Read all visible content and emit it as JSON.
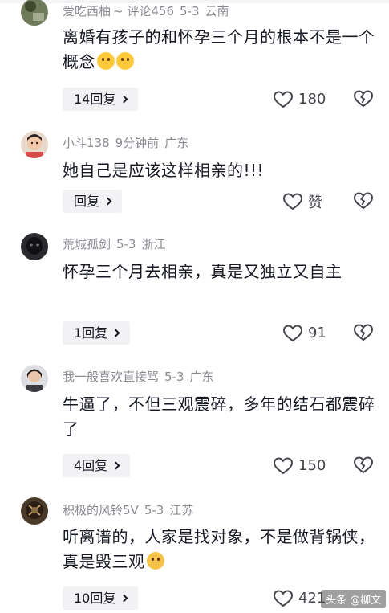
{
  "comments": [
    {
      "user": "爱吃西柚",
      "extra": "~ 评论456",
      "date": "5-3",
      "location": "云南",
      "text": "离婚有孩子的和怀孕三个月的根本不是一个概念",
      "emoji_count": 2,
      "reply_label": "14回复",
      "like_label": "180"
    },
    {
      "user": "小斗138",
      "extra": "",
      "date": "9分钟前",
      "location": "广东",
      "text": "她自己是应该这样相亲的!!!",
      "emoji_count": 0,
      "reply_label": "回复",
      "like_label": "赞"
    },
    {
      "user": "荒城孤剑",
      "extra": "",
      "date": "5-3",
      "location": "浙江",
      "text": "怀孕三个月去相亲，真是又独立又自主",
      "emoji_count": 0,
      "reply_label": "1回复",
      "like_label": "91"
    },
    {
      "user": "我一般喜欢直接骂",
      "extra": "",
      "date": "5-3",
      "location": "广东",
      "text": "牛逼了，不但三观震碎，多年的结石都震碎了",
      "emoji_count": 0,
      "reply_label": "4回复",
      "like_label": "150"
    },
    {
      "user": "积极的风铃5V",
      "extra": "",
      "date": "5-3",
      "location": "江苏",
      "text": "听离谱的，人家是找对象，不是做背锅侠，真是毁三观",
      "emoji_count": 1,
      "reply_label": "10回复",
      "like_label": "421"
    }
  ],
  "watermark": "头条 @柳文",
  "icons": {
    "like": "heart-outline-icon",
    "dislike": "broken-heart-icon",
    "chevron": "chevron-right-icon",
    "emoji": "smiley-emoji-icon"
  },
  "colors": {
    "meta_text": "#8a8b91",
    "body_text": "#161823",
    "reply_bg": "#f2f2f4"
  }
}
